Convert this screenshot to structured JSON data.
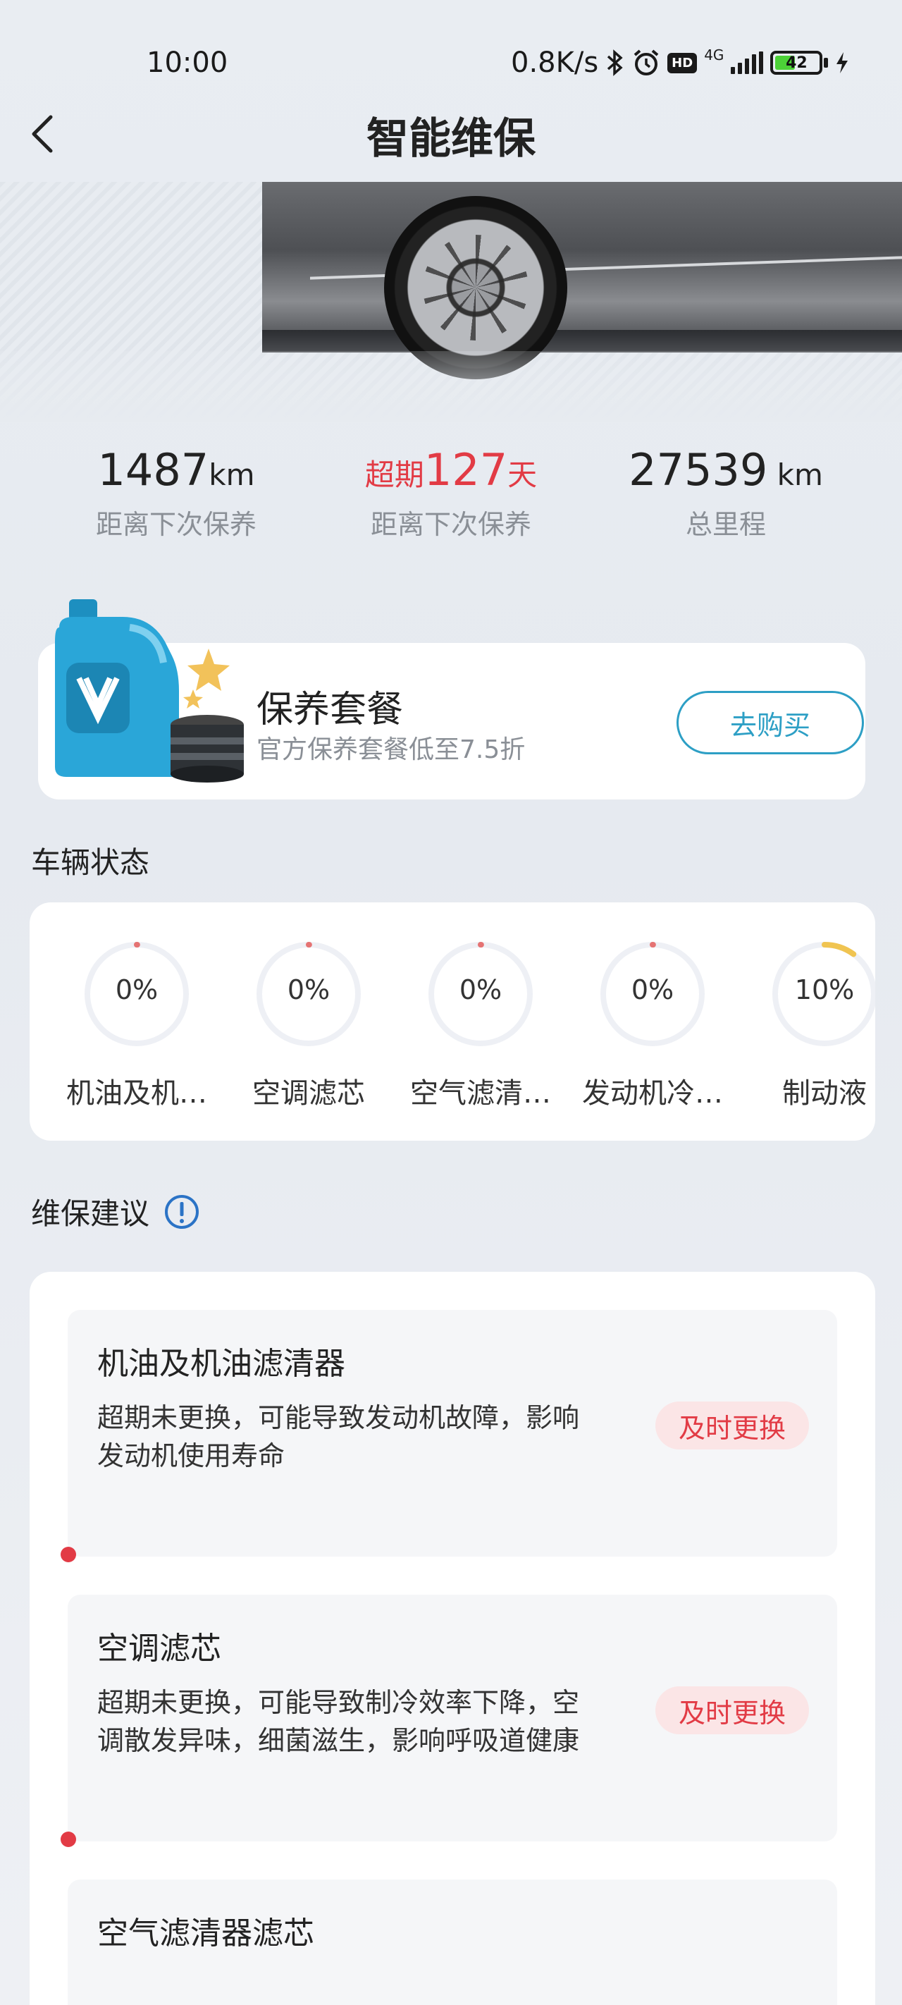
{
  "status_bar": {
    "time": "10:00",
    "net_speed": "0.8K/s",
    "hd": "HD",
    "network": "4G",
    "battery": "42"
  },
  "nav": {
    "title": "智能维保"
  },
  "stats": [
    {
      "prefix": "",
      "value": "1487",
      "unit": "km",
      "label": "距离下次保养"
    },
    {
      "prefix": "超期",
      "value": "127",
      "unit": "天",
      "label": "距离下次保养"
    },
    {
      "prefix": "",
      "value": "27539",
      "unit": " km",
      "label": "总里程"
    }
  ],
  "package": {
    "title": "保养套餐",
    "subtitle": "官方保养套餐低至7.5折",
    "button": "去购买"
  },
  "vehicle_status": {
    "title": "车辆状态",
    "items": [
      {
        "percent": "0%",
        "label": "机油及机…",
        "fraction": 0.0,
        "color": "#e57373"
      },
      {
        "percent": "0%",
        "label": "空调滤芯",
        "fraction": 0.0,
        "color": "#e57373"
      },
      {
        "percent": "0%",
        "label": "空气滤清…",
        "fraction": 0.0,
        "color": "#e57373"
      },
      {
        "percent": "0%",
        "label": "发动机冷…",
        "fraction": 0.0,
        "color": "#e57373"
      },
      {
        "percent": "10%",
        "label": "制动液",
        "fraction": 0.1,
        "color": "#f0c451"
      }
    ]
  },
  "advice": {
    "title": "维保建议",
    "items": [
      {
        "title": "机油及机油滤清器",
        "desc": "超期未更换，可能导致发动机故障，影响发动机使用寿命",
        "tag": "及时更换"
      },
      {
        "title": "空调滤芯",
        "desc": "超期未更换，可能导致制冷效率下降，空调散发异味，细菌滋生，影响呼吸道健康",
        "tag": "及时更换"
      },
      {
        "title": "空气滤清器滤芯",
        "desc": "",
        "tag": ""
      }
    ]
  }
}
